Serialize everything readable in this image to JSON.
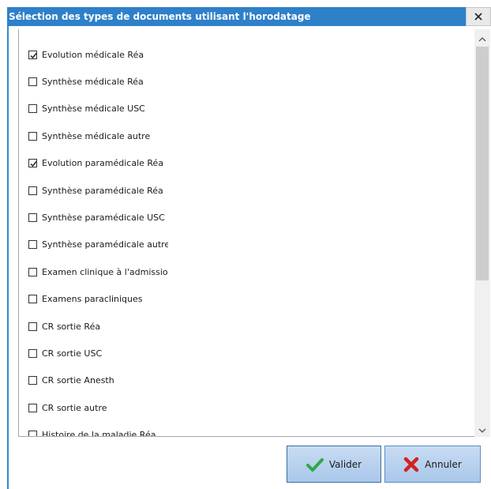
{
  "window": {
    "title": "Sélection des types de documents utilisant l'horodatage"
  },
  "list": {
    "items": [
      {
        "label": "Evolution médicale Réa",
        "checked": true
      },
      {
        "label": "Synthèse médicale Réa",
        "checked": false
      },
      {
        "label": "Synthèse médicale USC",
        "checked": false
      },
      {
        "label": "Synthèse médicale autre",
        "checked": false
      },
      {
        "label": "Evolution paramédicale Réa",
        "checked": true
      },
      {
        "label": "Synthèse paramédicale Réa",
        "checked": false
      },
      {
        "label": "Synthèse paramédicale USC",
        "checked": false
      },
      {
        "label": "Synthèse paramédicale autre",
        "checked": false
      },
      {
        "label": "Examen clinique à l'admission",
        "checked": false
      },
      {
        "label": "Examens paracliniques",
        "checked": false
      },
      {
        "label": "CR sortie Réa",
        "checked": false
      },
      {
        "label": "CR sortie USC",
        "checked": false
      },
      {
        "label": "CR sortie Anesth",
        "checked": false
      },
      {
        "label": "CR sortie autre",
        "checked": false
      },
      {
        "label": "Histoire de la maladie Réa",
        "checked": false
      }
    ]
  },
  "buttons": {
    "validate_label": "Valider",
    "cancel_label": "Annuler"
  },
  "icons": {
    "close": "close-icon",
    "check": "check-icon",
    "validate": "green-check-icon",
    "cancel": "red-cross-icon",
    "scroll_up": "chevron-up-icon",
    "scroll_down": "chevron-down-icon"
  },
  "colors": {
    "title_bar": "#2e80c9",
    "button_fill": "#b8d3ef",
    "validate_icon": "#2fa84a",
    "cancel_icon": "#d42020"
  }
}
